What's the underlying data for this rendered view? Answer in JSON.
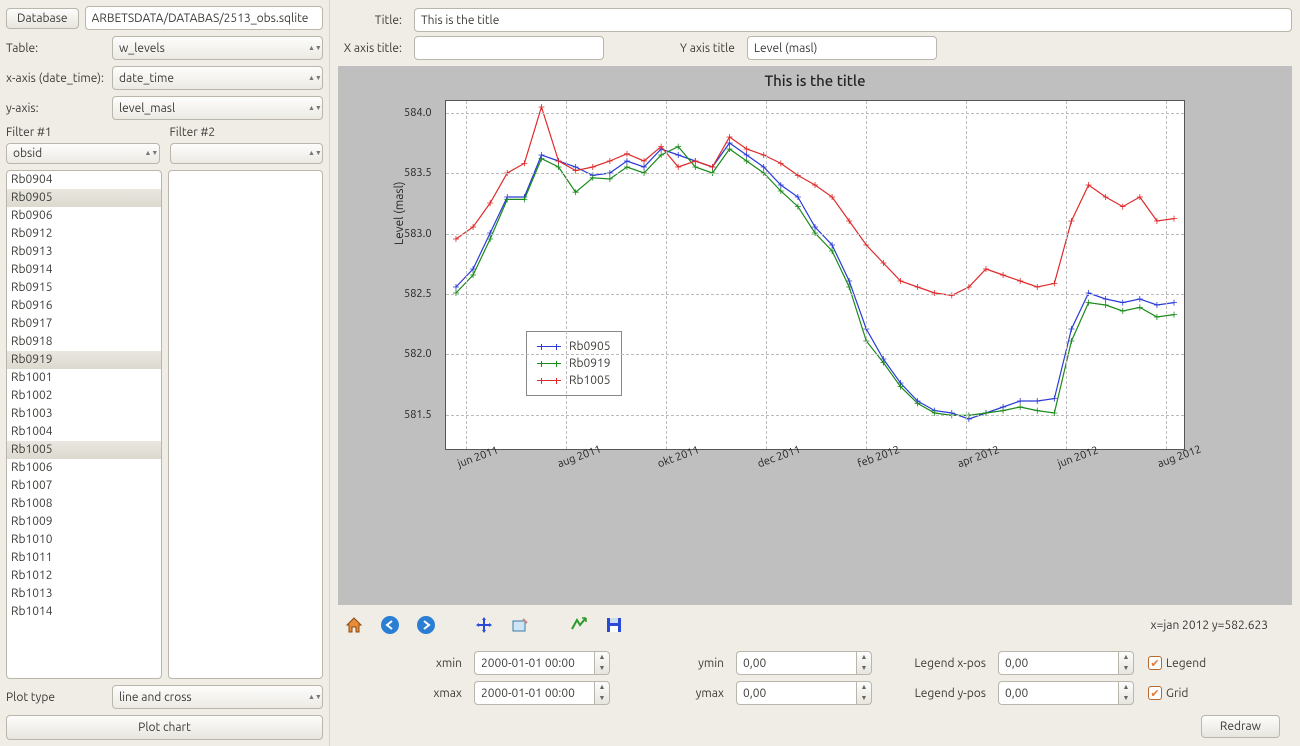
{
  "left": {
    "database_btn": "Database",
    "database_path": "ARBETSDATA/DATABAS/2513_obs.sqlite",
    "labels": {
      "table": "Table:",
      "xaxis": "x-axis (date_time):",
      "yaxis": "y-axis:",
      "filter1": "Filter #1",
      "filter2": "Filter #2",
      "plottype": "Plot type"
    },
    "table_sel": "w_levels",
    "xaxis_sel": "date_time",
    "yaxis_sel": "level_masl",
    "filter1_sel": "obsid",
    "filter2_sel": "",
    "list_items": [
      "Rb0904",
      "Rb0905",
      "Rb0906",
      "Rb0912",
      "Rb0913",
      "Rb0914",
      "Rb0915",
      "Rb0916",
      "Rb0917",
      "Rb0918",
      "Rb0919",
      "Rb1001",
      "Rb1002",
      "Rb1003",
      "Rb1004",
      "Rb1005",
      "Rb1006",
      "Rb1007",
      "Rb1008",
      "Rb1009",
      "Rb1010",
      "Rb1011",
      "Rb1012",
      "Rb1013",
      "Rb1014"
    ],
    "selected_items": [
      "Rb0905",
      "Rb0919",
      "Rb1005"
    ],
    "plottype_sel": "line and cross",
    "plot_btn": "Plot chart"
  },
  "top": {
    "title_lbl": "Title:",
    "title_val": "This is the title",
    "xaxis_lbl": "X axis title:",
    "xaxis_val": "",
    "yaxis_lbl": "Y axis title",
    "yaxis_val": "Level (masl)"
  },
  "chart_data": {
    "type": "line",
    "title": "This is the title",
    "ylabel": "Level (masl)",
    "xlabel": "",
    "xticks": [
      "jun 2011",
      "aug 2011",
      "okt 2011",
      "dec 2011",
      "feb 2012",
      "apr 2012",
      "jun 2012",
      "aug 2012"
    ],
    "yticks": [
      581.5,
      582.0,
      582.5,
      583.0,
      583.5,
      584.0
    ],
    "ylim": [
      581.2,
      584.1
    ],
    "series": [
      {
        "name": "Rb0905",
        "color": "#2a3bd7",
        "values": [
          582.55,
          582.7,
          583.0,
          583.3,
          583.3,
          583.65,
          583.6,
          583.55,
          583.48,
          583.5,
          583.6,
          583.55,
          583.7,
          583.65,
          583.6,
          583.55,
          583.75,
          583.65,
          583.55,
          583.4,
          583.3,
          583.05,
          582.9,
          582.6,
          582.2,
          581.95,
          581.75,
          581.6,
          581.52,
          581.5,
          581.45,
          581.5,
          581.55,
          581.6,
          581.6,
          581.62,
          582.2,
          582.5,
          582.45,
          582.42,
          582.45,
          582.4,
          582.42
        ]
      },
      {
        "name": "Rb0919",
        "color": "#1a8a1a",
        "values": [
          582.5,
          582.65,
          582.95,
          583.28,
          583.28,
          583.62,
          583.55,
          583.34,
          583.46,
          583.45,
          583.55,
          583.5,
          583.65,
          583.72,
          583.55,
          583.5,
          583.7,
          583.6,
          583.5,
          583.35,
          583.22,
          583.0,
          582.85,
          582.55,
          582.1,
          581.92,
          581.72,
          581.58,
          581.5,
          581.48,
          581.48,
          581.5,
          581.52,
          581.55,
          581.52,
          581.5,
          582.1,
          582.42,
          582.4,
          582.35,
          582.38,
          582.3,
          582.32
        ]
      },
      {
        "name": "Rb1005",
        "color": "#e02a2a",
        "values": [
          582.95,
          583.05,
          583.25,
          583.5,
          583.58,
          584.05,
          583.6,
          583.52,
          583.55,
          583.6,
          583.66,
          583.6,
          583.72,
          583.55,
          583.6,
          583.55,
          583.8,
          583.7,
          583.65,
          583.58,
          583.48,
          583.4,
          583.3,
          583.1,
          582.9,
          582.75,
          582.6,
          582.55,
          582.5,
          582.48,
          582.55,
          582.7,
          582.65,
          582.6,
          582.55,
          582.58,
          583.1,
          583.4,
          583.3,
          583.22,
          583.3,
          583.1,
          583.12
        ]
      }
    ]
  },
  "status": "x=jan 2012 y=582.623",
  "bottom": {
    "xmin_lbl": "xmin",
    "xmin": "2000-01-01 00:00",
    "xmax_lbl": "xmax",
    "xmax": "2000-01-01 00:00",
    "ymin_lbl": "ymin",
    "ymin": "0,00",
    "ymax_lbl": "ymax",
    "ymax": "0,00",
    "lx_lbl": "Legend x-pos",
    "lx": "0,00",
    "ly_lbl": "Legend y-pos",
    "ly": "0,00",
    "legend_lbl": "Legend",
    "grid_lbl": "Grid",
    "redraw": "Redraw"
  }
}
